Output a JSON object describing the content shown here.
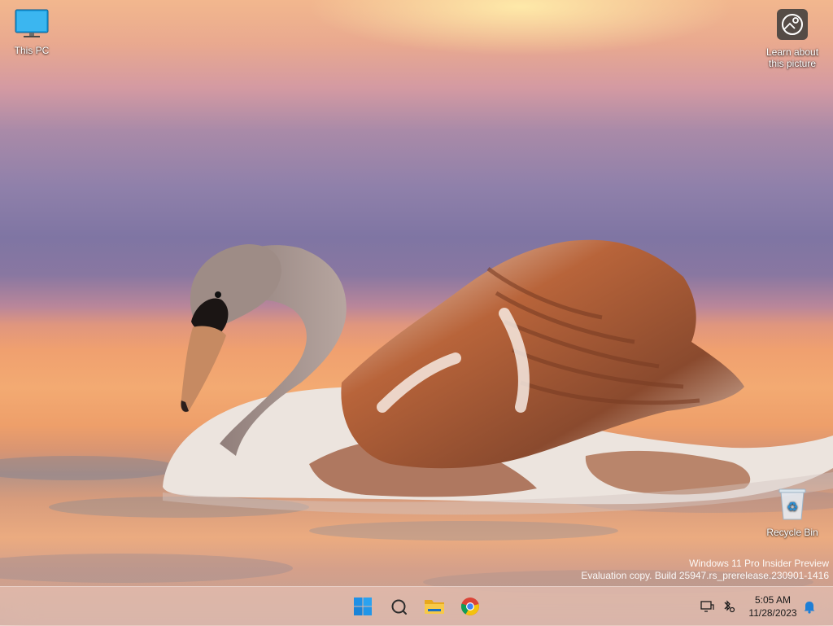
{
  "desktop": {
    "icons": [
      {
        "label": "This PC",
        "icon": "monitor-icon"
      },
      {
        "label_line1": "Learn about",
        "label_line2": "this picture",
        "icon": "camera-circle-icon"
      },
      {
        "label": "Recycle Bin",
        "icon": "recycle-bin-icon"
      }
    ]
  },
  "watermark": {
    "line1": "Windows 11 Pro Insider Preview",
    "line2": "Evaluation copy. Build 25947.rs_prerelease.230901-1416"
  },
  "taskbar": {
    "apps": [
      {
        "icon": "windows-start-icon"
      },
      {
        "icon": "search-icon"
      },
      {
        "icon": "file-explorer-icon"
      },
      {
        "icon": "chrome-icon"
      }
    ],
    "tray": {
      "icons": [
        "network-display-icon",
        "bluetooth-settings-icon",
        "notification-bell-icon"
      ],
      "time": "5:05 AM",
      "date": "11/28/2023"
    }
  },
  "colors": {
    "accent": "#0078d4",
    "wallpaper_sky": "#8f80aa",
    "wallpaper_water": "#f0a06f"
  }
}
